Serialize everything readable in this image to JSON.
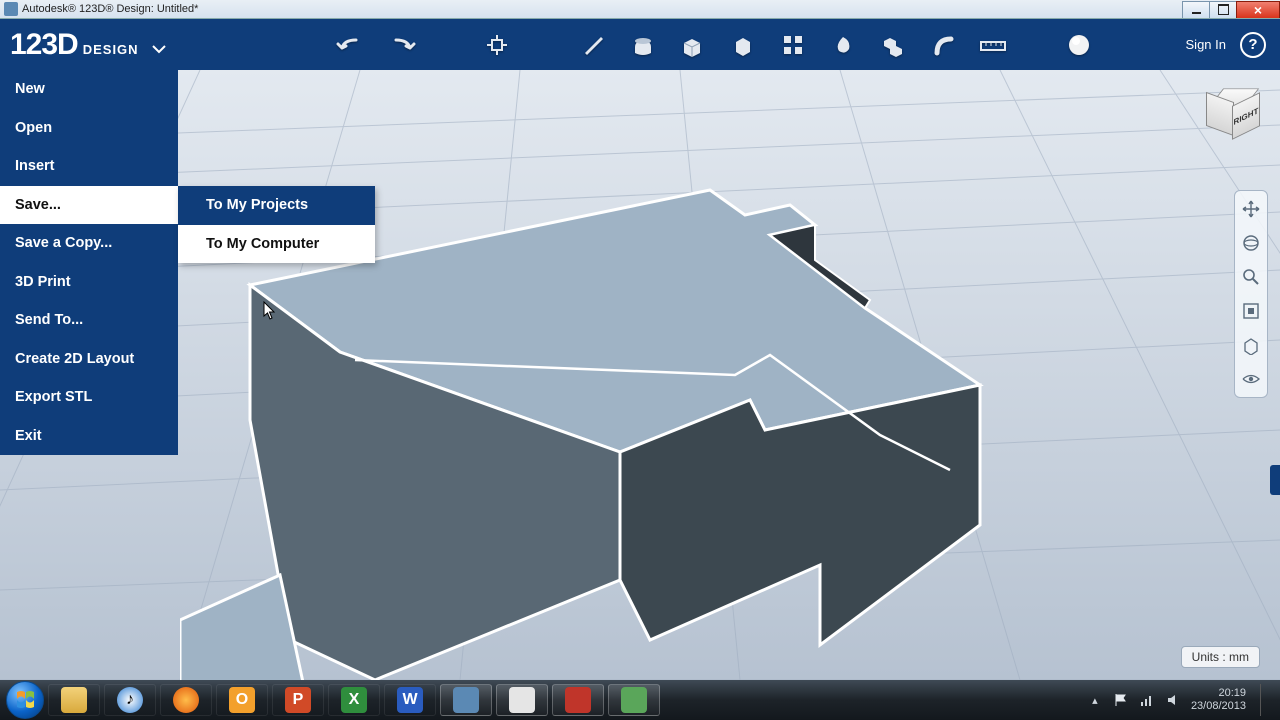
{
  "window": {
    "title": "Autodesk® 123D® Design: Untitled*"
  },
  "brand": {
    "num": "123D",
    "design": "DESIGN"
  },
  "toolbar": {
    "signin": "Sign In",
    "tools": [
      "undo",
      "redo",
      "",
      "transform",
      "",
      "sketch",
      "extrude",
      "primitives",
      "box",
      "pattern",
      "revolve",
      "combine",
      "fillet",
      "measure",
      "",
      "material-sphere"
    ]
  },
  "menu": {
    "items": [
      {
        "label": "New"
      },
      {
        "label": "Open"
      },
      {
        "label": "Insert"
      },
      {
        "label": "Save...",
        "highlight": true,
        "submenu": true
      },
      {
        "label": "Save a Copy..."
      },
      {
        "label": "3D Print"
      },
      {
        "label": "Send To..."
      },
      {
        "label": "Create 2D Layout"
      },
      {
        "label": "Export STL"
      },
      {
        "label": "Exit"
      }
    ]
  },
  "submenu": {
    "items": [
      {
        "label": "To My Projects",
        "highlight": true
      },
      {
        "label": "To My Computer"
      }
    ]
  },
  "viewcube": {
    "right": "RIGHT"
  },
  "right_strip_icons": [
    "pan",
    "orbit",
    "zoom",
    "fit",
    "look",
    "visibility"
  ],
  "units": "Units : mm",
  "taskbar": {
    "items": [
      "explorer",
      "itunes",
      "firefox",
      "outlook",
      "powerpoint",
      "excel",
      "word",
      "autodesk",
      "app2",
      "sketchup",
      "app3"
    ],
    "tray_icons": [
      "flag",
      "network",
      "speaker"
    ],
    "time": "20:19",
    "date": "23/08/2013"
  }
}
